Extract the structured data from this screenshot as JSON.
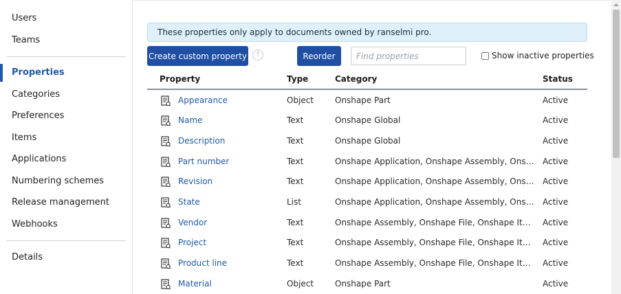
{
  "sidebar": {
    "items": [
      {
        "label": "Users"
      },
      {
        "label": "Teams"
      },
      {
        "label": "Properties"
      },
      {
        "label": "Categories"
      },
      {
        "label": "Preferences"
      },
      {
        "label": "Items"
      },
      {
        "label": "Applications"
      },
      {
        "label": "Numbering schemes"
      },
      {
        "label": "Release management"
      },
      {
        "label": "Webhooks"
      },
      {
        "label": "Details"
      }
    ],
    "active": "Properties"
  },
  "banner": {
    "text": "These properties only apply to documents owned by ranselmi pro."
  },
  "toolbar": {
    "create_label": "Create custom property",
    "reorder_label": "Reorder",
    "help_glyph": "?",
    "search_placeholder": "Find properties",
    "show_inactive_label": "Show inactive properties",
    "show_inactive_checked": false
  },
  "table": {
    "columns": [
      "Property",
      "Type",
      "Category",
      "Status"
    ],
    "rows": [
      {
        "name": "Appearance",
        "type": "Object",
        "category": "Onshape Part",
        "status": "Active"
      },
      {
        "name": "Name",
        "type": "Text",
        "category": "Onshape Global",
        "status": "Active"
      },
      {
        "name": "Description",
        "type": "Text",
        "category": "Onshape Global",
        "status": "Active"
      },
      {
        "name": "Part number",
        "type": "Text",
        "category": "Onshape Application, Onshape Assembly, Onshape ...",
        "status": "Active"
      },
      {
        "name": "Revision",
        "type": "Text",
        "category": "Onshape Application, Onshape Assembly, Onshape ...",
        "status": "Active"
      },
      {
        "name": "State",
        "type": "List",
        "category": "Onshape Application, Onshape Assembly, Onshape ...",
        "status": "Active"
      },
      {
        "name": "Vendor",
        "type": "Text",
        "category": "Onshape Assembly, Onshape File, Onshape Item, On...",
        "status": "Active"
      },
      {
        "name": "Project",
        "type": "Text",
        "category": "Onshape Assembly, Onshape File, Onshape Item, On...",
        "status": "Active"
      },
      {
        "name": "Product line",
        "type": "Text",
        "category": "Onshape Assembly, Onshape File, Onshape Item, On...",
        "status": "Active"
      },
      {
        "name": "Material",
        "type": "Object",
        "category": "Onshape Part",
        "status": "Active"
      }
    ]
  },
  "icons": {
    "row_icon": "property-document-icon"
  },
  "colors": {
    "accent": "#1f4fa3",
    "link": "#1f5aa8",
    "banner_bg": "#dff0fb"
  }
}
